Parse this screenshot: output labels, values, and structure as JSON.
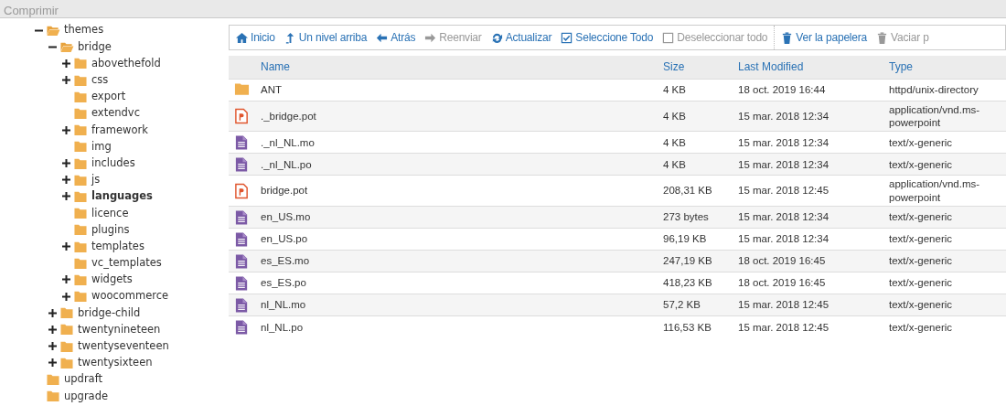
{
  "top_bar": {
    "label": "Comprimir"
  },
  "tree": [
    {
      "label": "themes",
      "expanded": true,
      "selected": false,
      "children": [
        {
          "label": "bridge",
          "expanded": true,
          "selected": false,
          "children": [
            {
              "label": "abovethefold",
              "expanded": false,
              "selected": false
            },
            {
              "label": "css",
              "expanded": false,
              "selected": false
            },
            {
              "label": "export",
              "selected": false
            },
            {
              "label": "extendvc",
              "selected": false
            },
            {
              "label": "framework",
              "expanded": false,
              "selected": false
            },
            {
              "label": "img",
              "selected": false
            },
            {
              "label": "includes",
              "expanded": false,
              "selected": false
            },
            {
              "label": "js",
              "expanded": false,
              "selected": false
            },
            {
              "label": "languages",
              "expanded": false,
              "selected": true
            },
            {
              "label": "licence",
              "selected": false
            },
            {
              "label": "plugins",
              "selected": false
            },
            {
              "label": "templates",
              "expanded": false,
              "selected": false
            },
            {
              "label": "vc_templates",
              "selected": false
            },
            {
              "label": "widgets",
              "expanded": false,
              "selected": false
            },
            {
              "label": "woocommerce",
              "expanded": false,
              "selected": false
            }
          ]
        },
        {
          "label": "bridge-child",
          "expanded": false,
          "selected": false
        },
        {
          "label": "twentynineteen",
          "expanded": false,
          "selected": false
        },
        {
          "label": "twentyseventeen",
          "expanded": false,
          "selected": false
        },
        {
          "label": "twentysixteen",
          "expanded": false,
          "selected": false
        }
      ]
    },
    {
      "label": "updraft",
      "selected": false
    },
    {
      "label": "upgrade",
      "selected": false
    }
  ],
  "toolbar": [
    {
      "label": "Inicio",
      "disabled": false
    },
    {
      "label": "Un nivel arriba",
      "disabled": false
    },
    {
      "label": "Atrás",
      "disabled": false
    },
    {
      "label": "Reenviar",
      "disabled": true
    },
    {
      "label": "Actualizar",
      "disabled": false
    },
    {
      "label": "Seleccione Todo",
      "disabled": false
    },
    {
      "label": "Deseleccionar todo",
      "disabled": true
    },
    {
      "label": "Ver la papelera",
      "disabled": false
    },
    {
      "label": "Vaciar p",
      "disabled": true
    }
  ],
  "table": {
    "columns": [
      "Name",
      "Size",
      "Last Modified",
      "Type"
    ],
    "rows": [
      {
        "kind": "folder",
        "name": "ANT",
        "size": "4 KB",
        "modified": "18 oct. 2019 16:44",
        "type": "httpd/unix-directory"
      },
      {
        "kind": "powerpoint",
        "name": "._bridge.pot",
        "size": "4 KB",
        "modified": "15 mar. 2018 12:34",
        "type": "application/vnd.ms-powerpoint"
      },
      {
        "kind": "text",
        "name": "._nl_NL.mo",
        "size": "4 KB",
        "modified": "15 mar. 2018 12:34",
        "type": "text/x-generic"
      },
      {
        "kind": "text",
        "name": "._nl_NL.po",
        "size": "4 KB",
        "modified": "15 mar. 2018 12:34",
        "type": "text/x-generic"
      },
      {
        "kind": "powerpoint",
        "name": "bridge.pot",
        "size": "208,31 KB",
        "modified": "15 mar. 2018 12:45",
        "type": "application/vnd.ms-powerpoint"
      },
      {
        "kind": "text",
        "name": "en_US.mo",
        "size": "273 bytes",
        "modified": "15 mar. 2018 12:34",
        "type": "text/x-generic"
      },
      {
        "kind": "text",
        "name": "en_US.po",
        "size": "96,19 KB",
        "modified": "15 mar. 2018 12:34",
        "type": "text/x-generic"
      },
      {
        "kind": "text",
        "name": "es_ES.mo",
        "size": "247,19 KB",
        "modified": "18 oct. 2019 16:45",
        "type": "text/x-generic"
      },
      {
        "kind": "text",
        "name": "es_ES.po",
        "size": "418,23 KB",
        "modified": "18 oct. 2019 16:45",
        "type": "text/x-generic"
      },
      {
        "kind": "text",
        "name": "nl_NL.mo",
        "size": "57,2 KB",
        "modified": "15 mar. 2018 12:45",
        "type": "text/x-generic"
      },
      {
        "kind": "text",
        "name": "nl_NL.po",
        "size": "116,53 KB",
        "modified": "15 mar. 2018 12:45",
        "type": "text/x-generic"
      }
    ]
  }
}
